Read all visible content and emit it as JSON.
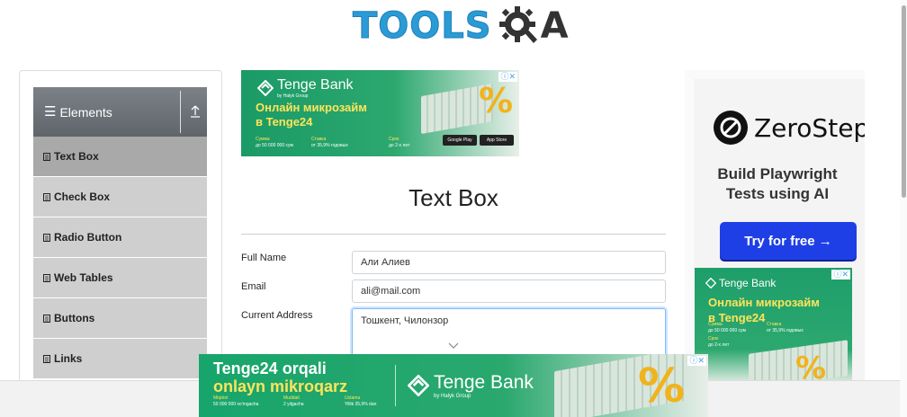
{
  "header": {
    "logo_text": "TOOLS",
    "logo_suffix": "A",
    "logo_mid": "Q"
  },
  "sidebar": {
    "group_title": "Elements",
    "items": [
      {
        "label": "Text Box",
        "active": true
      },
      {
        "label": "Check Box",
        "active": false
      },
      {
        "label": "Radio Button",
        "active": false
      },
      {
        "label": "Web Tables",
        "active": false
      },
      {
        "label": "Buttons",
        "active": false
      },
      {
        "label": "Links",
        "active": false
      }
    ]
  },
  "ad_top": {
    "bank": "Tenge Bank",
    "bank_sub": "by Halyk Group",
    "headline_1": "Онлайн микрозайм",
    "headline_2": "в Tenge24",
    "col1_a": "Сумма",
    "col1_b": "до 50 000 000 сум",
    "col2_a": "Ставка",
    "col2_b": "от 35,9% годовых",
    "col3_a": "Срок",
    "col3_b": "до 2-х лет",
    "store1": "Google Play",
    "store2": "App Store",
    "percent": "%"
  },
  "main": {
    "title": "Text Box",
    "fields": {
      "full_name_label": "Full Name",
      "full_name_value": "Али Алиев",
      "email_label": "Email",
      "email_value": "ali@mail.com",
      "address_label": "Current Address",
      "address_value": "Тошкент, Чилонзор"
    }
  },
  "ad_right": {
    "brand": "ZeroStep",
    "headline_1": "Build Playwright",
    "headline_2": "Tests using AI",
    "cta": "Try for free →"
  },
  "ad_right2": {
    "bank": "Tenge Bank",
    "headline_1": "Онлайн микрозайм",
    "headline_2": "в Tenge24",
    "col1_a": "Сумма",
    "col1_b": "до 50 000 000 сум",
    "col2_a": "Ставка",
    "col2_b": "от 35,9% годовых",
    "col3_a": "Срок",
    "col3_b": "до 2-х лет"
  },
  "ad_bottom": {
    "line1": "Tenge24 orqali",
    "line2": "onlayn mikroqarz",
    "col1_a": "Miqdori",
    "col1_b": "50 000 000 so'mgacha",
    "col2_a": "Muddati",
    "col2_b": "2 yilgacha",
    "col3_a": "Ustama",
    "col3_b": "Yillik 35,9% dan",
    "bank": "Tenge Bank",
    "bank_sub": "by Halyk Group"
  },
  "colors": {
    "logo_blue": "#2b9bd6",
    "sidebar_header": "#6b7177",
    "menu_bg": "#cfcfcf",
    "menu_active": "#a9a9a9",
    "bank_green": "#2ca86f",
    "cta_blue": "#1f3fe6"
  }
}
